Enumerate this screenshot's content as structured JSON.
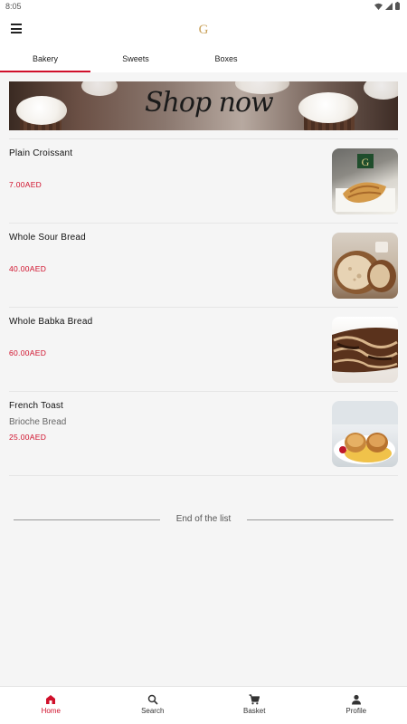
{
  "status": {
    "time": "8:05"
  },
  "app": {
    "logo_letter": "G"
  },
  "tabs": [
    {
      "label": "Bakery",
      "active": true
    },
    {
      "label": "Sweets",
      "active": false
    },
    {
      "label": "Boxes",
      "active": false
    }
  ],
  "banner": {
    "text": "Shop now"
  },
  "products": [
    {
      "name": "Plain Croissant",
      "subtitle": "",
      "price": "7.00AED",
      "image_icon": "croissant-image"
    },
    {
      "name": "Whole Sour Bread",
      "subtitle": "",
      "price": "40.00AED",
      "image_icon": "sourdough-image"
    },
    {
      "name": "Whole Babka Bread",
      "subtitle": "",
      "price": "60.00AED",
      "image_icon": "babka-image"
    },
    {
      "name": "French Toast",
      "subtitle": "Brioche Bread",
      "price": "25.00AED",
      "image_icon": "french-toast-image"
    }
  ],
  "end_of_list": "End of the list",
  "bottom_nav": [
    {
      "label": "Home",
      "icon": "home-icon",
      "active": true
    },
    {
      "label": "Search",
      "icon": "search-icon",
      "active": false
    },
    {
      "label": "Basket",
      "icon": "cart-icon",
      "active": false
    },
    {
      "label": "Profile",
      "icon": "person-icon",
      "active": false
    }
  ],
  "colors": {
    "accent": "#d0102b",
    "logo_gold": "#c9a15a"
  }
}
